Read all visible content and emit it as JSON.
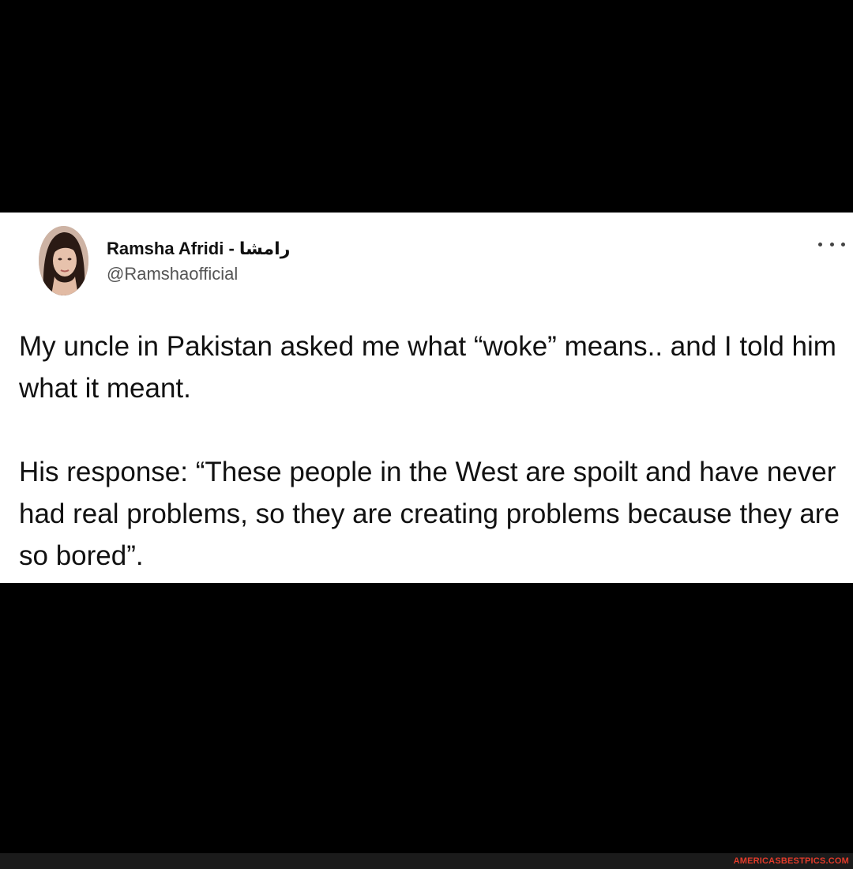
{
  "tweet": {
    "author": {
      "display_name": "Ramsha Afridi - رامشا",
      "handle": "@Ramshaofficial",
      "avatar": "profile-photo"
    },
    "more_icon": "more-horizontal-icon",
    "text_paragraphs": [
      "My uncle in Pakistan asked me what “woke” means.. and I told him what it meant.",
      "His response: “These people in the West are spoilt and have never had real problems, so they are creating problems because they are so bored”."
    ]
  },
  "footer": {
    "watermark": "AMERICASBESTPICS.COM"
  },
  "colors": {
    "background": "#000000",
    "card": "#ffffff",
    "text": "#111111",
    "handle": "#555555",
    "watermark": "#e23b2a"
  }
}
